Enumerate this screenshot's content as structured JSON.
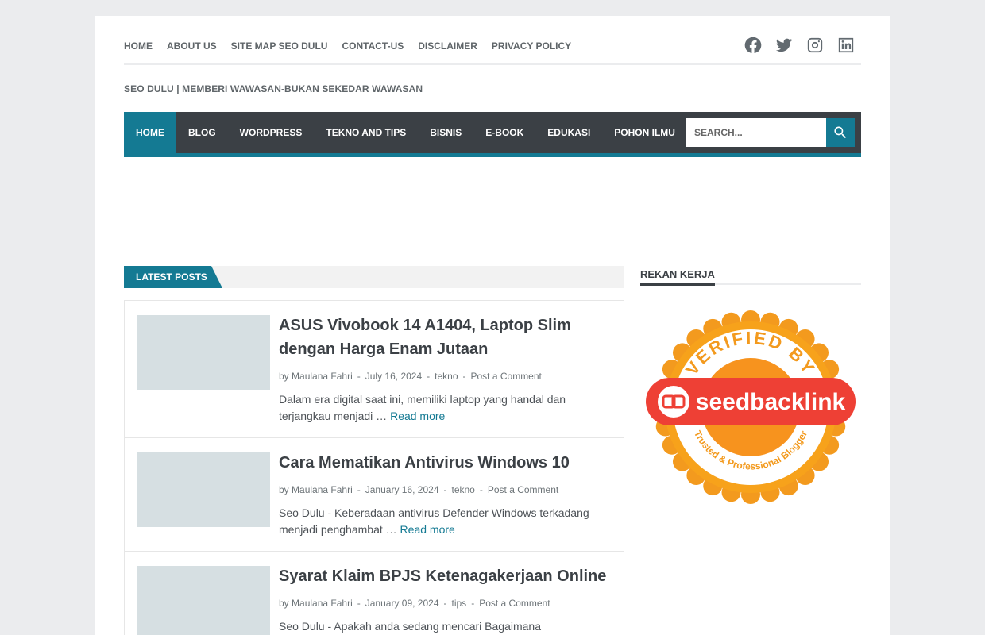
{
  "top_nav": [
    "HOME",
    "ABOUT US",
    "SITE MAP SEO DULU",
    "CONTACT-US",
    "DISCLAIMER",
    "PRIVACY POLICY"
  ],
  "social": [
    "facebook-icon",
    "twitter-icon",
    "instagram-icon",
    "linkedin-icon"
  ],
  "tagline": "SEO DULU | MEMBERI WAWASAN-BUKAN SEKEDAR WAWASAN",
  "main_nav": [
    "HOME",
    "BLOG",
    "WORDPRESS",
    "TEKNO AND TIPS",
    "BISNIS",
    "E-BOOK",
    "EDUKASI",
    "POHON ILMU"
  ],
  "search": {
    "placeholder": "Search..."
  },
  "latest_label": "LATEST POSTS",
  "posts": [
    {
      "title": "ASUS Vivobook 14 A1404, Laptop Slim dengan Harga Enam Jutaan",
      "by": "by",
      "author": "Maulana Fahri",
      "date": "July 16, 2024",
      "category": "tekno",
      "comment": "Post a Comment",
      "excerpt": "Dalam era digital saat ini, memiliki laptop yang handal dan terjangkau menjadi …",
      "more": "Read more"
    },
    {
      "title": "Cara Mematikan Antivirus Windows 10",
      "by": "by",
      "author": "Maulana Fahri",
      "date": "January 16, 2024",
      "category": "tekno",
      "comment": "Post a Comment",
      "excerpt": "Seo Dulu - Keberadaan antivirus Defender Windows terkadang menjadi penghambat …",
      "more": "Read more"
    },
    {
      "title": "Syarat Klaim BPJS Ketenagakerjaan Online",
      "by": "by",
      "author": "Maulana Fahri",
      "date": "January 09, 2024",
      "category": "tips",
      "comment": "Post a Comment",
      "excerpt": "Seo Dulu -  Apakah anda sedang mencari Bagaimana",
      "more": ""
    }
  ],
  "sidebar": {
    "heading": "REKAN KERJA",
    "badge": {
      "top_text": "VERIFIED BY",
      "brand": "seedbacklink",
      "bottom_text": "Trusted & Professional Blogger"
    }
  },
  "colors": {
    "accent": "#147a93",
    "nav_bg": "#3b4045",
    "badge_orange": "#f39a1e",
    "badge_red": "#ee4035"
  }
}
